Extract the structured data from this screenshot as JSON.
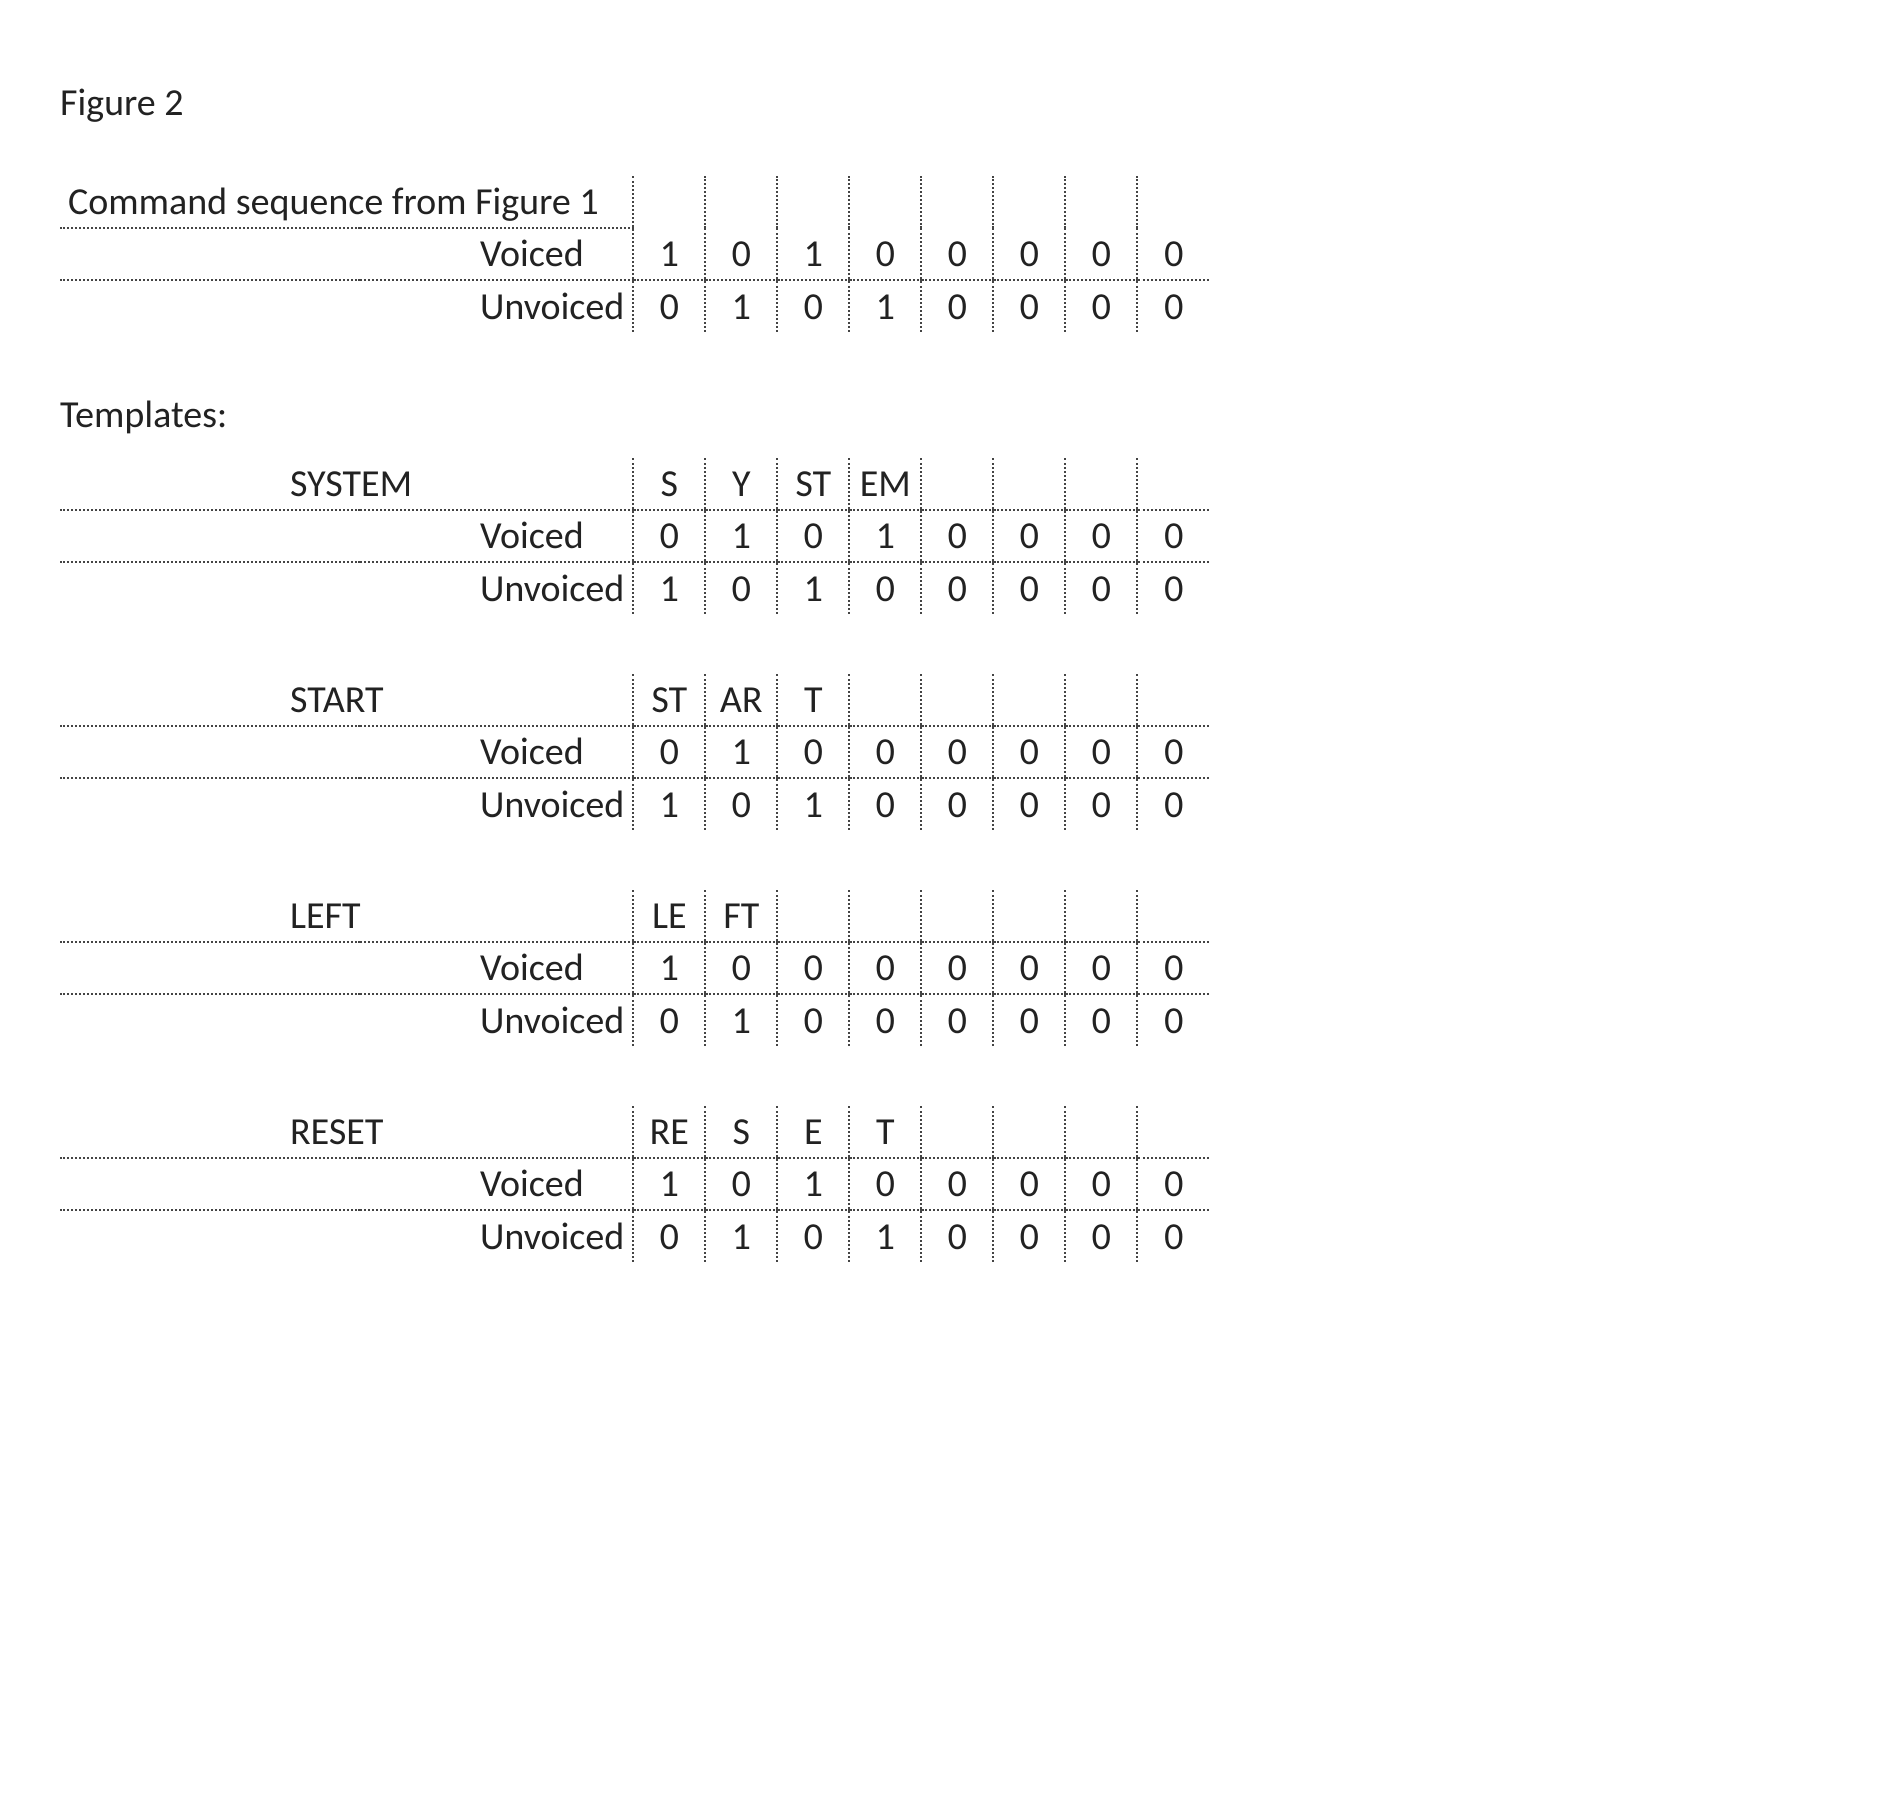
{
  "figure_title": "Figure 2",
  "command_sequence_label": "Command sequence from Figure 1",
  "voiced_label": "Voiced",
  "unvoiced_label": "Unvoiced",
  "templates_label": "Templates:",
  "command": {
    "voiced": [
      "1",
      "0",
      "1",
      "0",
      "0",
      "0",
      "0",
      "0"
    ],
    "unvoiced": [
      "0",
      "1",
      "0",
      "1",
      "0",
      "0",
      "0",
      "0"
    ]
  },
  "templates": [
    {
      "name": "SYSTEM",
      "segments": [
        "S",
        "Y",
        "ST",
        "EM",
        "",
        "",
        "",
        ""
      ],
      "voiced": [
        "0",
        "1",
        "0",
        "1",
        "0",
        "0",
        "0",
        "0"
      ],
      "unvoiced": [
        "1",
        "0",
        "1",
        "0",
        "0",
        "0",
        "0",
        "0"
      ]
    },
    {
      "name": "START",
      "segments": [
        "ST",
        "AR",
        "T",
        "",
        "",
        "",
        "",
        ""
      ],
      "voiced": [
        "0",
        "1",
        "0",
        "0",
        "0",
        "0",
        "0",
        "0"
      ],
      "unvoiced": [
        "1",
        "0",
        "1",
        "0",
        "0",
        "0",
        "0",
        "0"
      ]
    },
    {
      "name": "LEFT",
      "segments": [
        "LE",
        "FT",
        "",
        "",
        "",
        "",
        "",
        ""
      ],
      "voiced": [
        "1",
        "0",
        "0",
        "0",
        "0",
        "0",
        "0",
        "0"
      ],
      "unvoiced": [
        "0",
        "1",
        "0",
        "0",
        "0",
        "0",
        "0",
        "0"
      ]
    },
    {
      "name": "RESET",
      "segments": [
        "RE",
        "S",
        "E",
        "T",
        "",
        "",
        "",
        ""
      ],
      "voiced": [
        "1",
        "0",
        "1",
        "0",
        "0",
        "0",
        "0",
        "0"
      ],
      "unvoiced": [
        "0",
        "1",
        "0",
        "1",
        "0",
        "0",
        "0",
        "0"
      ]
    }
  ]
}
